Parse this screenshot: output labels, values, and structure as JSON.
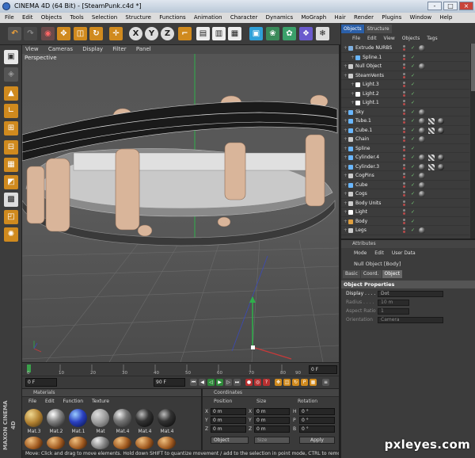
{
  "window": {
    "title": "CINEMA 4D (64 Bit) - [SteamPunk.c4d *]",
    "controls": [
      "-",
      "□",
      "×"
    ]
  },
  "menu": [
    "File",
    "Edit",
    "Objects",
    "Tools",
    "Selection",
    "Structure",
    "Functions",
    "Animation",
    "Character",
    "Dynamics",
    "MoGraph",
    "Hair",
    "Render",
    "Plugins",
    "Window",
    "Help"
  ],
  "viewport": {
    "menu": [
      "View",
      "Cameras",
      "Display",
      "Filter",
      "Panel"
    ],
    "label": "Perspective"
  },
  "timeline": {
    "ticks": [
      "0",
      "10",
      "20",
      "30",
      "40",
      "50",
      "60",
      "70",
      "80",
      "90"
    ],
    "current_frame": "0 F",
    "start": "0 F",
    "end": "90 F"
  },
  "materials": {
    "title": "Materials",
    "menu": [
      "File",
      "Edit",
      "Function",
      "Texture"
    ],
    "items": [
      "Mat.3",
      "Mat.2",
      "Mat.1",
      "Mat",
      "Mat.4",
      "Mat.4",
      "Mat.4"
    ]
  },
  "coordinates": {
    "title": "Coordinates",
    "headers": [
      "Position",
      "Size",
      "Rotation"
    ],
    "rows": [
      {
        "label": "X",
        "pos": "0 m",
        "size_label": "X",
        "size": "0 m",
        "rot_label": "H",
        "rot": "0 °"
      },
      {
        "label": "Y",
        "pos": "0 m",
        "size_label": "Y",
        "size": "0 m",
        "rot_label": "P",
        "rot": "0 °"
      },
      {
        "label": "Z",
        "pos": "0 m",
        "size_label": "Z",
        "size": "0 m",
        "rot_label": "B",
        "rot": "0 °"
      }
    ],
    "mode": "Object",
    "size_mode": "Size",
    "apply": "Apply"
  },
  "status": "Move: Click and drag to move elements. Hold down SHIFT to quantize movement / add to the selection in point mode, CTRL to remove.",
  "objects_panel": {
    "tabs": [
      {
        "label": "Objects",
        "active": true
      },
      {
        "label": "Structure",
        "active": false
      }
    ],
    "menu": [
      "File",
      "Edit",
      "View",
      "Objects",
      "Tags"
    ],
    "items": [
      {
        "name": "Extrude NURBS",
        "indent": 1,
        "color": "#7fb0e0"
      },
      {
        "name": "Spline.1",
        "indent": 2,
        "color": "#6ab7ff"
      },
      {
        "name": "Null Object",
        "indent": 1,
        "color": "#cccccc"
      },
      {
        "name": "SteamVents",
        "indent": 1,
        "color": "#cccccc"
      },
      {
        "name": "Light.3",
        "indent": 2,
        "color": "#ffffff"
      },
      {
        "name": "Light.2",
        "indent": 2,
        "color": "#ffffff"
      },
      {
        "name": "Light.1",
        "indent": 2,
        "color": "#ffffff"
      },
      {
        "name": "Sky",
        "indent": 1,
        "color": "#6ab7ff"
      },
      {
        "name": "Tube.1",
        "indent": 1,
        "color": "#6ab7ff"
      },
      {
        "name": "Cube.1",
        "indent": 1,
        "color": "#6ab7ff"
      },
      {
        "name": "Chain",
        "indent": 1,
        "color": "#cccccc"
      },
      {
        "name": "Spline",
        "indent": 1,
        "color": "#6ab7ff"
      },
      {
        "name": "Cylinder.4",
        "indent": 1,
        "color": "#6ab7ff"
      },
      {
        "name": "Cylinder.3",
        "indent": 1,
        "color": "#6ab7ff"
      },
      {
        "name": "CogPins",
        "indent": 1,
        "color": "#cccccc"
      },
      {
        "name": "Cube",
        "indent": 1,
        "color": "#6ab7ff"
      },
      {
        "name": "Cogs",
        "indent": 1,
        "color": "#cccccc"
      },
      {
        "name": "Body Units",
        "indent": 1,
        "color": "#cccccc"
      },
      {
        "name": "Light",
        "indent": 1,
        "color": "#ffffff"
      },
      {
        "name": "Body",
        "indent": 1,
        "color": "#e0a040"
      },
      {
        "name": "Legs",
        "indent": 1,
        "color": "#cccccc"
      }
    ]
  },
  "attributes": {
    "title": "Attributes",
    "menu": [
      "Mode",
      "Edit",
      "User Data"
    ],
    "object": "Null Object [Body]",
    "tabs": [
      {
        "label": "Basic",
        "active": false
      },
      {
        "label": "Coord.",
        "active": false
      },
      {
        "label": "Object",
        "active": true
      }
    ],
    "section": "Object Properties",
    "props": [
      {
        "label": "Display . . . .",
        "value": "Dot"
      },
      {
        "label": "Radius . . . .",
        "value": "10 m"
      },
      {
        "label": "Aspect Ratio",
        "value": "1"
      },
      {
        "label": "Orientation",
        "value": "Camera"
      }
    ]
  },
  "watermark": "pxleyes.com",
  "colors": {
    "ui_bg": "#3c3c3c",
    "accent": "#2b5fa8",
    "viewport": "#555555",
    "cylinder": "#d9b59a"
  }
}
